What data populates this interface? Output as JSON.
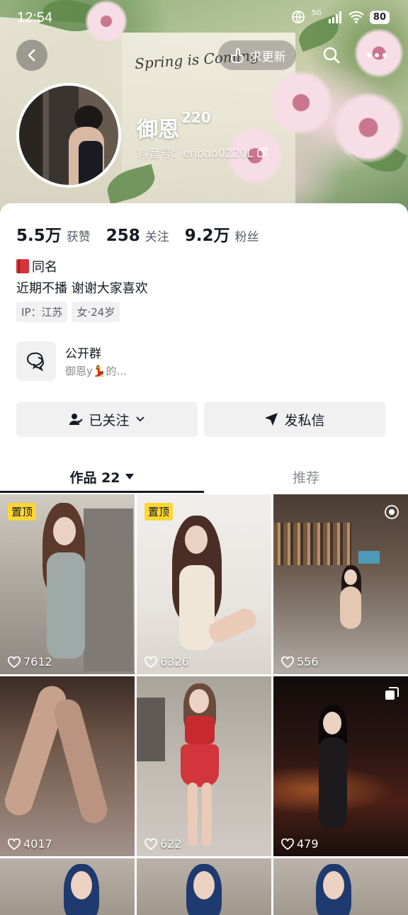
{
  "status_bar": {
    "time": "12:54",
    "network": "5G",
    "battery": "80"
  },
  "cover": {
    "script_text": "Spring is Coming"
  },
  "header": {
    "request_update_label": "求更新"
  },
  "profile": {
    "nickname": "御恩",
    "nickname_suffix": "220",
    "douyin_id": "抖音号：enbao0220L"
  },
  "stats": [
    {
      "value": "5.5万",
      "label": "获赞"
    },
    {
      "value": "258",
      "label": "关注"
    },
    {
      "value": "9.2万",
      "label": "粉丝"
    }
  ],
  "bio": {
    "line1": "同名",
    "line2": "近期不播 谢谢大家喜欢"
  },
  "tags": [
    "IP：江苏",
    "女·24岁"
  ],
  "group": {
    "title": "公开群",
    "subtitle": "御恩y💃的..."
  },
  "actions": {
    "followed_label": "已关注",
    "message_label": "发私信"
  },
  "tabs": {
    "works_label": "作品 22",
    "recommend_label": "推荐"
  },
  "videos": [
    {
      "likes": "7612",
      "pinned_label": "置顶"
    },
    {
      "likes": "6326",
      "pinned_label": "置顶"
    },
    {
      "likes": "556"
    },
    {
      "likes": "4017"
    },
    {
      "likes": "622"
    },
    {
      "likes": "479"
    }
  ],
  "colors": {
    "pin_badge": "#fcd635",
    "text_primary": "#161823",
    "card_bg": "#f1f1f2"
  },
  "icons": [
    "back-icon",
    "hand-pointer-icon",
    "search-icon",
    "more-icon",
    "copy-icon",
    "chat-bubbles-icon",
    "user-check-icon",
    "chevron-down-icon",
    "send-icon",
    "triangle-down-icon",
    "heart-icon",
    "live-icon",
    "gallery-icon"
  ]
}
